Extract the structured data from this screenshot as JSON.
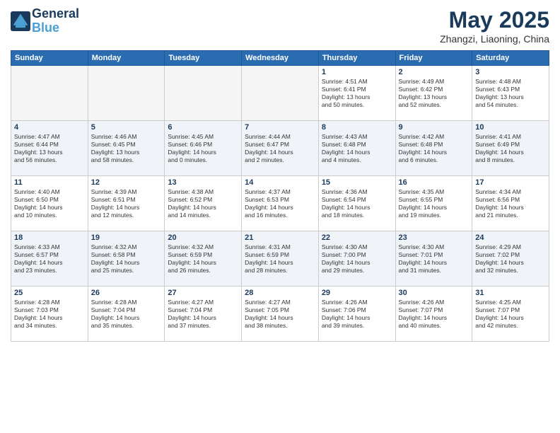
{
  "header": {
    "logo_line1": "General",
    "logo_line2": "Blue",
    "month": "May 2025",
    "location": "Zhangzi, Liaoning, China"
  },
  "weekdays": [
    "Sunday",
    "Monday",
    "Tuesday",
    "Wednesday",
    "Thursday",
    "Friday",
    "Saturday"
  ],
  "rows": [
    [
      {
        "day": "",
        "info": ""
      },
      {
        "day": "",
        "info": ""
      },
      {
        "day": "",
        "info": ""
      },
      {
        "day": "",
        "info": ""
      },
      {
        "day": "1",
        "info": "Sunrise: 4:51 AM\nSunset: 6:41 PM\nDaylight: 13 hours\nand 50 minutes."
      },
      {
        "day": "2",
        "info": "Sunrise: 4:49 AM\nSunset: 6:42 PM\nDaylight: 13 hours\nand 52 minutes."
      },
      {
        "day": "3",
        "info": "Sunrise: 4:48 AM\nSunset: 6:43 PM\nDaylight: 13 hours\nand 54 minutes."
      }
    ],
    [
      {
        "day": "4",
        "info": "Sunrise: 4:47 AM\nSunset: 6:44 PM\nDaylight: 13 hours\nand 56 minutes."
      },
      {
        "day": "5",
        "info": "Sunrise: 4:46 AM\nSunset: 6:45 PM\nDaylight: 13 hours\nand 58 minutes."
      },
      {
        "day": "6",
        "info": "Sunrise: 4:45 AM\nSunset: 6:46 PM\nDaylight: 14 hours\nand 0 minutes."
      },
      {
        "day": "7",
        "info": "Sunrise: 4:44 AM\nSunset: 6:47 PM\nDaylight: 14 hours\nand 2 minutes."
      },
      {
        "day": "8",
        "info": "Sunrise: 4:43 AM\nSunset: 6:48 PM\nDaylight: 14 hours\nand 4 minutes."
      },
      {
        "day": "9",
        "info": "Sunrise: 4:42 AM\nSunset: 6:48 PM\nDaylight: 14 hours\nand 6 minutes."
      },
      {
        "day": "10",
        "info": "Sunrise: 4:41 AM\nSunset: 6:49 PM\nDaylight: 14 hours\nand 8 minutes."
      }
    ],
    [
      {
        "day": "11",
        "info": "Sunrise: 4:40 AM\nSunset: 6:50 PM\nDaylight: 14 hours\nand 10 minutes."
      },
      {
        "day": "12",
        "info": "Sunrise: 4:39 AM\nSunset: 6:51 PM\nDaylight: 14 hours\nand 12 minutes."
      },
      {
        "day": "13",
        "info": "Sunrise: 4:38 AM\nSunset: 6:52 PM\nDaylight: 14 hours\nand 14 minutes."
      },
      {
        "day": "14",
        "info": "Sunrise: 4:37 AM\nSunset: 6:53 PM\nDaylight: 14 hours\nand 16 minutes."
      },
      {
        "day": "15",
        "info": "Sunrise: 4:36 AM\nSunset: 6:54 PM\nDaylight: 14 hours\nand 18 minutes."
      },
      {
        "day": "16",
        "info": "Sunrise: 4:35 AM\nSunset: 6:55 PM\nDaylight: 14 hours\nand 19 minutes."
      },
      {
        "day": "17",
        "info": "Sunrise: 4:34 AM\nSunset: 6:56 PM\nDaylight: 14 hours\nand 21 minutes."
      }
    ],
    [
      {
        "day": "18",
        "info": "Sunrise: 4:33 AM\nSunset: 6:57 PM\nDaylight: 14 hours\nand 23 minutes."
      },
      {
        "day": "19",
        "info": "Sunrise: 4:32 AM\nSunset: 6:58 PM\nDaylight: 14 hours\nand 25 minutes."
      },
      {
        "day": "20",
        "info": "Sunrise: 4:32 AM\nSunset: 6:59 PM\nDaylight: 14 hours\nand 26 minutes."
      },
      {
        "day": "21",
        "info": "Sunrise: 4:31 AM\nSunset: 6:59 PM\nDaylight: 14 hours\nand 28 minutes."
      },
      {
        "day": "22",
        "info": "Sunrise: 4:30 AM\nSunset: 7:00 PM\nDaylight: 14 hours\nand 29 minutes."
      },
      {
        "day": "23",
        "info": "Sunrise: 4:30 AM\nSunset: 7:01 PM\nDaylight: 14 hours\nand 31 minutes."
      },
      {
        "day": "24",
        "info": "Sunrise: 4:29 AM\nSunset: 7:02 PM\nDaylight: 14 hours\nand 32 minutes."
      }
    ],
    [
      {
        "day": "25",
        "info": "Sunrise: 4:28 AM\nSunset: 7:03 PM\nDaylight: 14 hours\nand 34 minutes."
      },
      {
        "day": "26",
        "info": "Sunrise: 4:28 AM\nSunset: 7:04 PM\nDaylight: 14 hours\nand 35 minutes."
      },
      {
        "day": "27",
        "info": "Sunrise: 4:27 AM\nSunset: 7:04 PM\nDaylight: 14 hours\nand 37 minutes."
      },
      {
        "day": "28",
        "info": "Sunrise: 4:27 AM\nSunset: 7:05 PM\nDaylight: 14 hours\nand 38 minutes."
      },
      {
        "day": "29",
        "info": "Sunrise: 4:26 AM\nSunset: 7:06 PM\nDaylight: 14 hours\nand 39 minutes."
      },
      {
        "day": "30",
        "info": "Sunrise: 4:26 AM\nSunset: 7:07 PM\nDaylight: 14 hours\nand 40 minutes."
      },
      {
        "day": "31",
        "info": "Sunrise: 4:25 AM\nSunset: 7:07 PM\nDaylight: 14 hours\nand 42 minutes."
      }
    ]
  ]
}
